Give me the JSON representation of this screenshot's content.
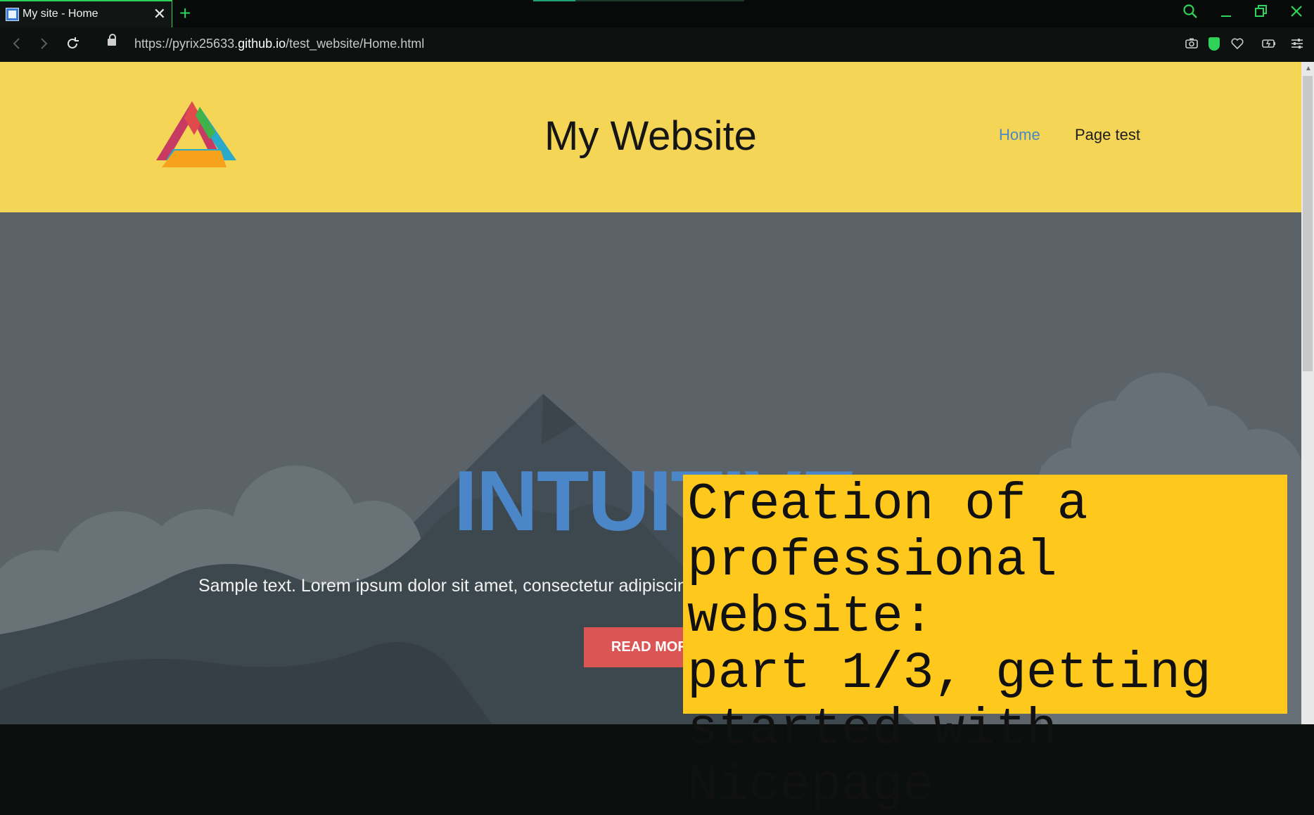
{
  "browser": {
    "tab": {
      "title": "My site - Home",
      "close_glyph": "✕"
    },
    "new_tab_glyph": "+",
    "window_controls": [
      "search-icon",
      "minimize-icon",
      "restore-icon",
      "close-icon"
    ],
    "address": {
      "url_prefix": "https://pyrix25633.",
      "url_host": "github.io",
      "url_path": "/test_website/Home.html"
    },
    "toolbar_icons": [
      "camera-icon",
      "shield-icon",
      "heart-icon",
      "battery-icon",
      "settings-sliders-icon"
    ]
  },
  "site": {
    "title": "My Website",
    "nav": {
      "home": "Home",
      "page_test": "Page test"
    }
  },
  "hero": {
    "title": "INTUITIVE",
    "text": "Sample text. Lorem ipsum dolor sit amet, consectetur adipiscing elit nullam nunc justo sagittis suscipit ultrices.",
    "button": "READ MORE"
  },
  "caption": {
    "lines": [
      "Creation of a",
      "professional website:",
      "part 1/3, getting",
      "started with Nicepage"
    ]
  },
  "colors": {
    "header_bg": "#f4d555",
    "hero_bg": "#5b6368",
    "accent_blue": "#4a86c8",
    "button_red": "#db5555",
    "caption_bg": "#fec81c",
    "browser_accent": "#2fd35a"
  }
}
